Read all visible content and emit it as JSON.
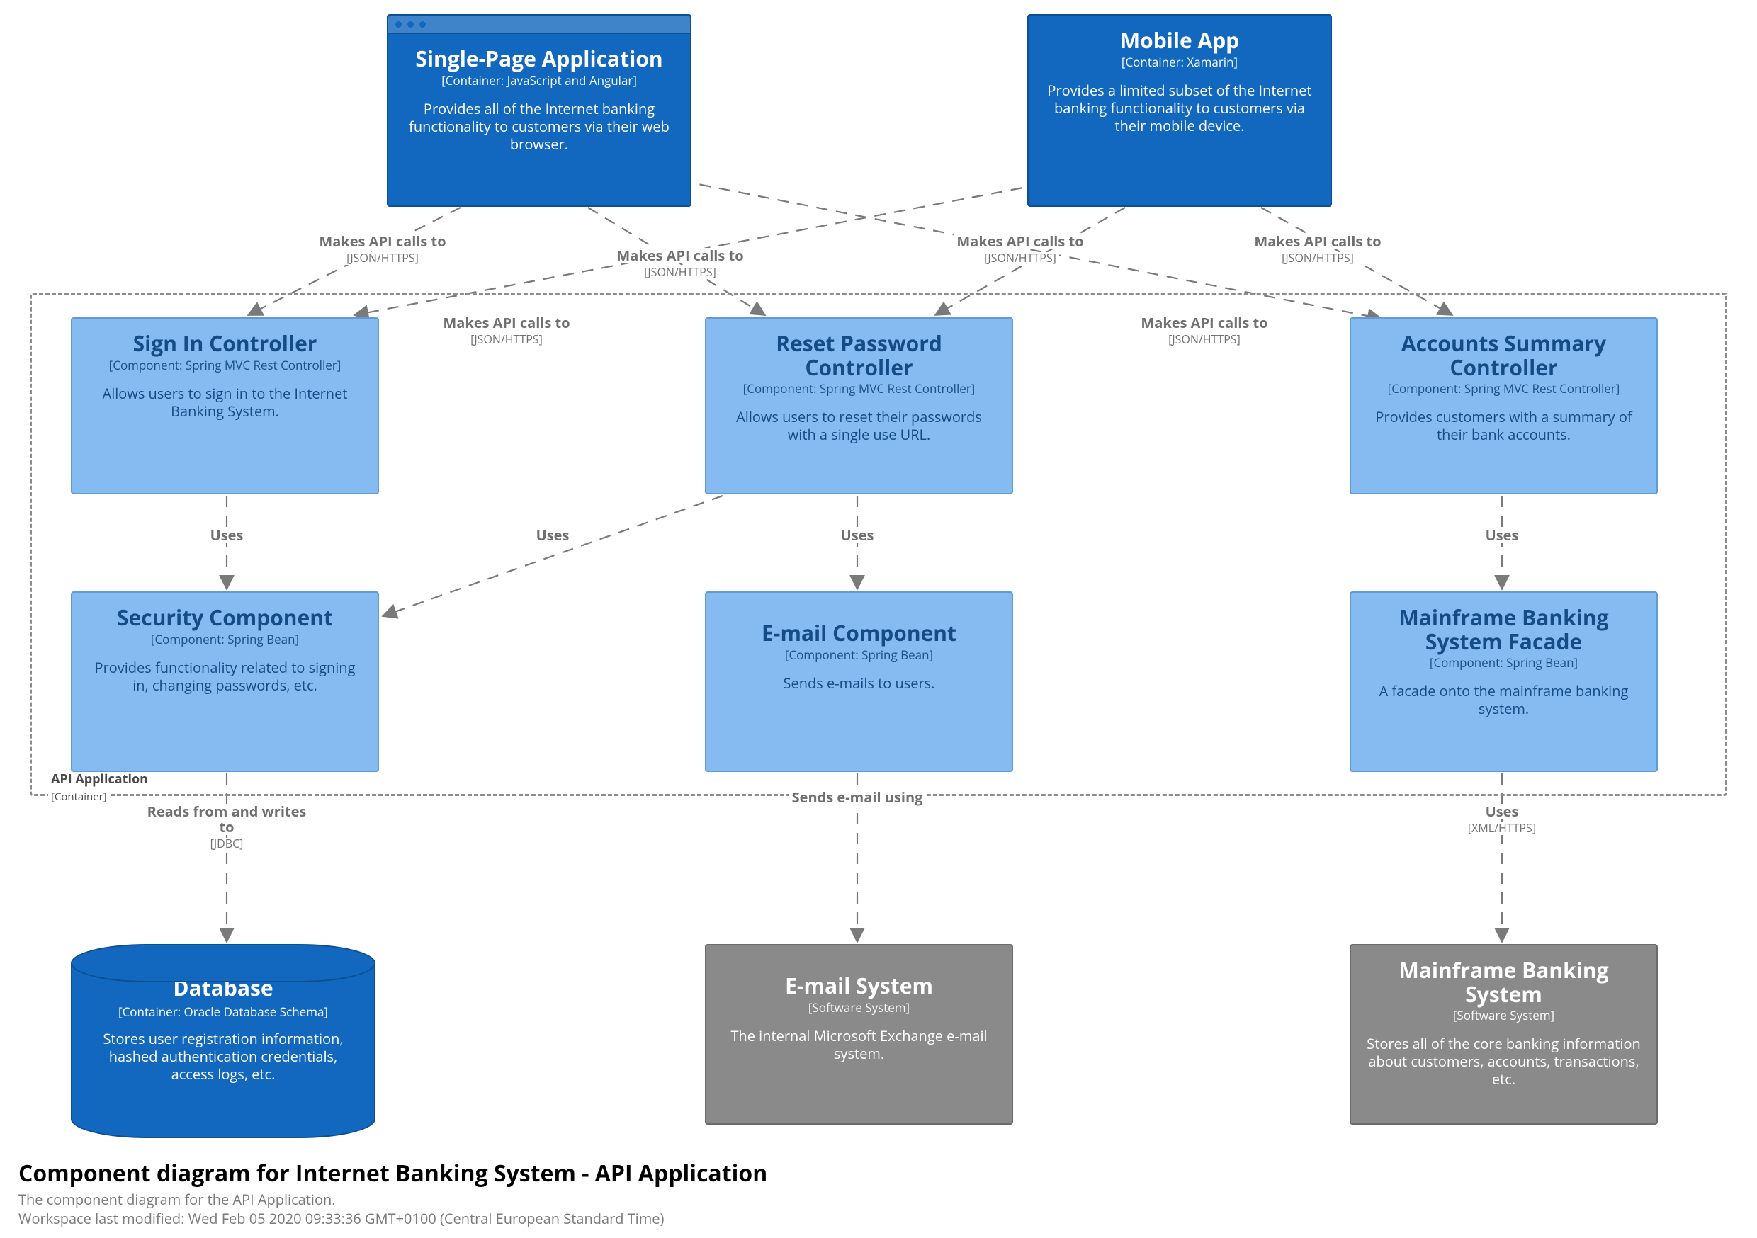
{
  "title": "Component diagram for Internet Banking System - API Application",
  "subtitle": "The component diagram for the API Application.",
  "timestamp": "Workspace last modified: Wed Feb 05 2020 09:33:36 GMT+0100 (Central European Standard Time)",
  "api_container": {
    "label": "API Application",
    "tech": "[Container]"
  },
  "nodes": {
    "spa": {
      "name": "Single-Page Application",
      "tech": "[Container: JavaScript and Angular]",
      "desc": "Provides all of the Internet banking functionality to customers via their web browser."
    },
    "mobile": {
      "name": "Mobile App",
      "tech": "[Container: Xamarin]",
      "desc": "Provides a limited subset of the Internet banking functionality to customers via their mobile device."
    },
    "signin": {
      "name": "Sign In Controller",
      "tech": "[Component: Spring MVC Rest Controller]",
      "desc": "Allows users to sign in to the Internet Banking System."
    },
    "reset": {
      "name": "Reset Password Controller",
      "tech": "[Component: Spring MVC Rest Controller]",
      "desc": "Allows users to reset their passwords with a single use URL."
    },
    "accounts": {
      "name": "Accounts Summary Controller",
      "tech": "[Component: Spring MVC Rest Controller]",
      "desc": "Provides customers with a summary of their bank accounts."
    },
    "security": {
      "name": "Security Component",
      "tech": "[Component: Spring Bean]",
      "desc": "Provides functionality related to signing in, changing passwords, etc."
    },
    "emailc": {
      "name": "E-mail Component",
      "tech": "[Component: Spring Bean]",
      "desc": "Sends e-mails to users."
    },
    "facade": {
      "name": "Mainframe Banking System Facade",
      "tech": "[Component: Spring Bean]",
      "desc": "A facade onto the mainframe banking system."
    },
    "db": {
      "name": "Database",
      "tech": "[Container: Oracle Database Schema]",
      "desc": "Stores user registration information, hashed authentication credentials, access logs, etc."
    },
    "emailsys": {
      "name": "E-mail System",
      "tech": "[Software System]",
      "desc": "The internal Microsoft Exchange e-mail system."
    },
    "mainframe": {
      "name": "Mainframe Banking System",
      "tech": "[Software System]",
      "desc": "Stores all of the core banking information about customers, accounts, transactions, etc."
    }
  },
  "edges": {
    "api_https": {
      "label": "Makes API calls to",
      "tech": "[JSON/HTTPS]"
    },
    "uses": {
      "label": "Uses",
      "tech": ""
    },
    "reads_writes": {
      "label": "Reads from and writes to",
      "tech": "[JDBC]"
    },
    "sends_email": {
      "label": "Sends e-mail using",
      "tech": ""
    },
    "uses_xml": {
      "label": "Uses",
      "tech": "[XML/HTTPS]"
    }
  }
}
